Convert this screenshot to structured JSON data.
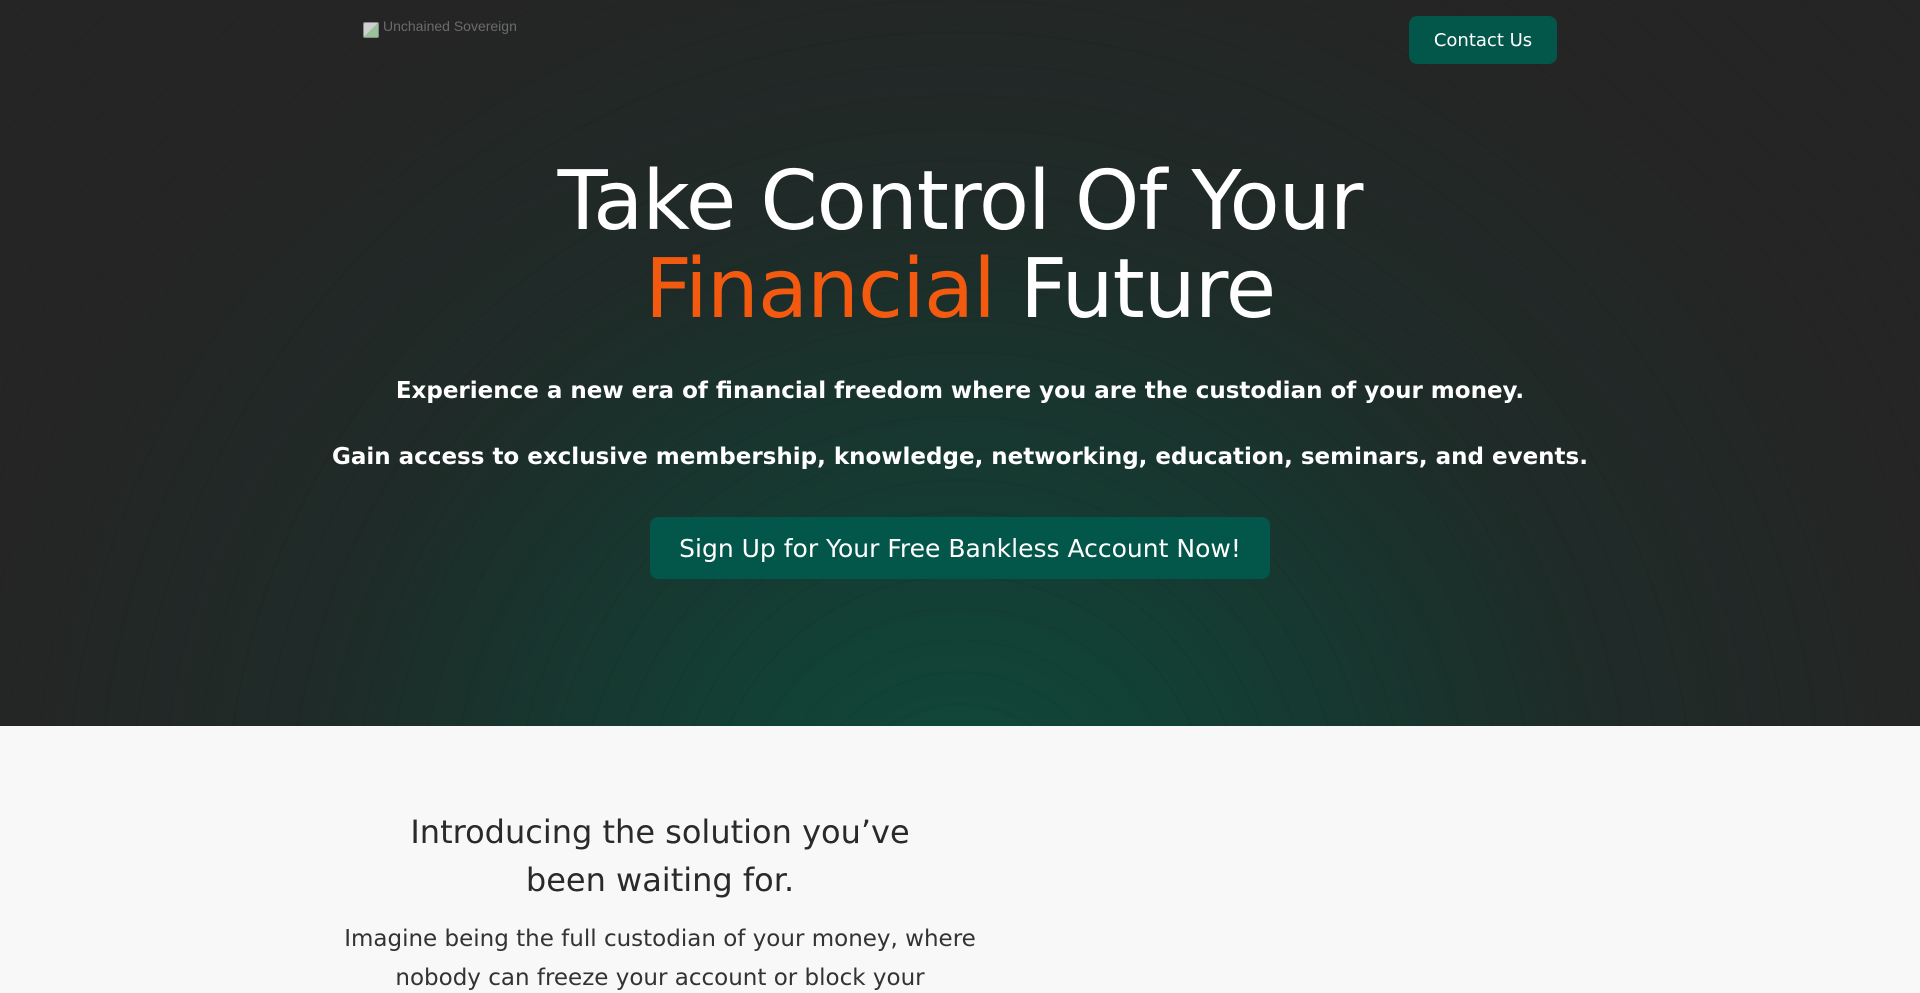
{
  "header": {
    "logo_alt": "Unchained Sovereign",
    "contact_label": "Contact Us"
  },
  "hero": {
    "headline_line1": "Take Control Of Your",
    "headline_accent": "Financial",
    "headline_rest": " Future",
    "subtitle1": "Experience a new era of financial freedom where you are the custodian of your money.",
    "subtitle2": "Gain access to exclusive membership, knowledge, networking, education, seminars, and events.",
    "cta_label": "Sign Up for Your Free Bankless Account Now!"
  },
  "intro": {
    "title_line1": "Introducing the solution you’ve",
    "title_line2": "been waiting for.",
    "body_line1": "Imagine being the full custodian of your money, where",
    "body_line2": "nobody can freeze your account or block your transactions."
  },
  "colors": {
    "accent": "#f45a0f",
    "brand_green": "#03564a",
    "hero_dark": "#252525"
  }
}
